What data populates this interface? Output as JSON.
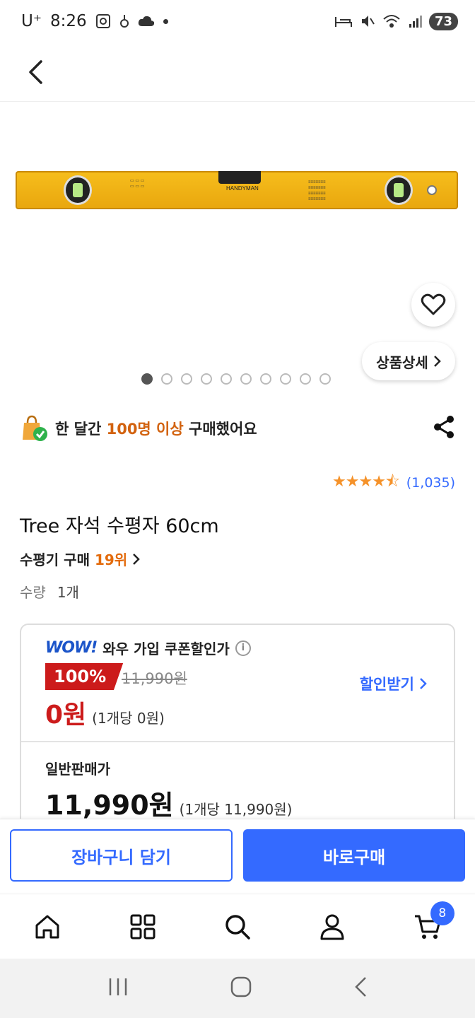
{
  "status": {
    "carrier": "U⁺",
    "time": "8:26",
    "battery": "73"
  },
  "product": {
    "title": "Tree 자석 수평자 60cm",
    "detail_btn": "상품상세",
    "image_brand": "HANDYMAN",
    "image_count": 10,
    "active_image": 1
  },
  "social_proof": {
    "pre": "한 달간 ",
    "highlight": "100명 이상",
    "post": " 구매했어요"
  },
  "rating": {
    "value": 4.5,
    "count": "(1,035)"
  },
  "rank": {
    "label": "수평기 구매 ",
    "value": "19위"
  },
  "quantity": {
    "label": "수량",
    "value": "1개"
  },
  "wow": {
    "logo": "WOW!",
    "label": "와우 가입 쿠폰할인가",
    "discount": "100%",
    "original_price": "11,990원",
    "price": "0원",
    "unit_price": "(1개당 0원)",
    "coupon_link": "할인받기"
  },
  "normal": {
    "label": "일반판매가",
    "price": "11,990원",
    "unit_price": "(1개당 11,990원)"
  },
  "actions": {
    "cart": "장바구니 담기",
    "buy": "바로구매"
  },
  "nav": {
    "cart_badge": "8"
  },
  "colors": {
    "accent": "#346aff",
    "discount_red": "#cc1b1b",
    "highlight_orange": "#d2620f"
  }
}
